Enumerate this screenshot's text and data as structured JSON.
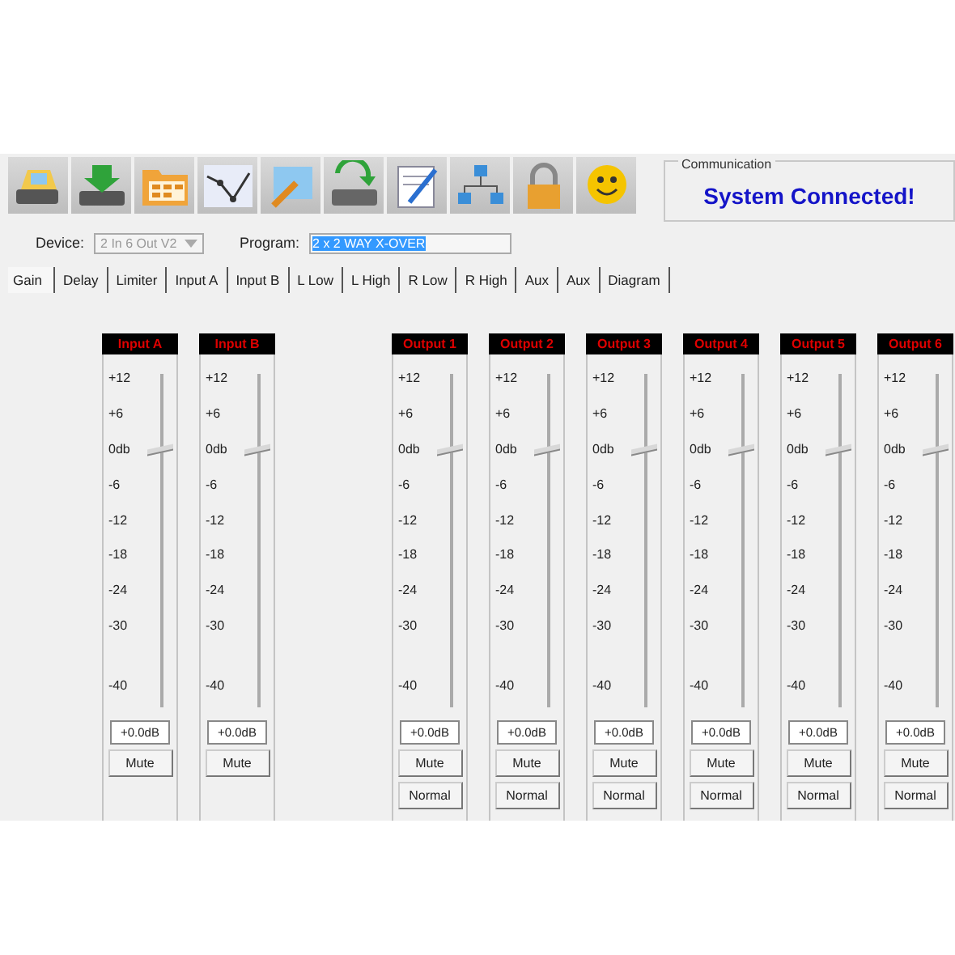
{
  "communication": {
    "title": "Communication",
    "status": "System Connected!"
  },
  "device": {
    "label": "Device:",
    "value": "2 In 6 Out V2",
    "disabled": true
  },
  "program": {
    "label": "Program:",
    "value": "2 x 2 WAY X-OVER",
    "selected": true
  },
  "tabs": [
    {
      "label": "Gain",
      "selected": true
    },
    {
      "label": "Delay",
      "selected": false
    },
    {
      "label": "Limiter",
      "selected": false
    },
    {
      "label": "Input A",
      "selected": false
    },
    {
      "label": "Input B",
      "selected": false
    },
    {
      "label": "L Low",
      "selected": false
    },
    {
      "label": "L High",
      "selected": false
    },
    {
      "label": "R Low",
      "selected": false
    },
    {
      "label": "R High",
      "selected": false
    },
    {
      "label": "Aux",
      "selected": false
    },
    {
      "label": "Aux",
      "selected": false
    },
    {
      "label": "Diagram",
      "selected": false
    }
  ],
  "channels": [
    {
      "kind": "input",
      "name": "Input A",
      "scale": [
        "+12",
        "+6",
        "0db",
        "-6",
        "-12",
        "-18",
        "-24",
        "-30",
        "-40"
      ],
      "level": 0.77,
      "reading": "+0.0dB",
      "mute": "Mute"
    },
    {
      "kind": "input",
      "name": "Input B",
      "scale": [
        "+12",
        "+6",
        "0db",
        "-6",
        "-12",
        "-18",
        "-24",
        "-30",
        "-40"
      ],
      "level": 0.77,
      "reading": "+0.0dB",
      "mute": "Mute"
    },
    {
      "kind": "output",
      "name": "Output 1",
      "scale": [
        "+12",
        "+6",
        "0db",
        "-6",
        "-12",
        "-18",
        "-24",
        "-30",
        "-40"
      ],
      "level": 0.77,
      "reading": "+0.0dB",
      "mute": "Mute",
      "mode": "Normal"
    },
    {
      "kind": "output",
      "name": "Output 2",
      "scale": [
        "+12",
        "+6",
        "0db",
        "-6",
        "-12",
        "-18",
        "-24",
        "-30",
        "-40"
      ],
      "level": 0.77,
      "reading": "+0.0dB",
      "mute": "Mute",
      "mode": "Normal"
    },
    {
      "kind": "output",
      "name": "Output 3",
      "scale": [
        "+12",
        "+6",
        "0db",
        "-6",
        "-12",
        "-18",
        "-24",
        "-30",
        "-40"
      ],
      "level": 0.77,
      "reading": "+0.0dB",
      "mute": "Mute",
      "mode": "Normal"
    },
    {
      "kind": "output",
      "name": "Output 4",
      "scale": [
        "+12",
        "+6",
        "0db",
        "-6",
        "-12",
        "-18",
        "-24",
        "-30",
        "-40"
      ],
      "level": 0.77,
      "reading": "+0.0dB",
      "mute": "Mute",
      "mode": "Normal"
    },
    {
      "kind": "output",
      "name": "Output 5",
      "scale": [
        "+12",
        "+6",
        "0db",
        "-6",
        "-12",
        "-18",
        "-24",
        "-30",
        "-40"
      ],
      "level": 0.77,
      "reading": "+0.0dB",
      "mute": "Mute",
      "mode": "Normal"
    },
    {
      "kind": "output",
      "name": "Output 6",
      "scale": [
        "+12",
        "+6",
        "0db",
        "-6",
        "-12",
        "-18",
        "-24",
        "-30",
        "-40"
      ],
      "level": 0.77,
      "reading": "+0.0dB",
      "mute": "Mute",
      "mode": "Normal"
    }
  ]
}
